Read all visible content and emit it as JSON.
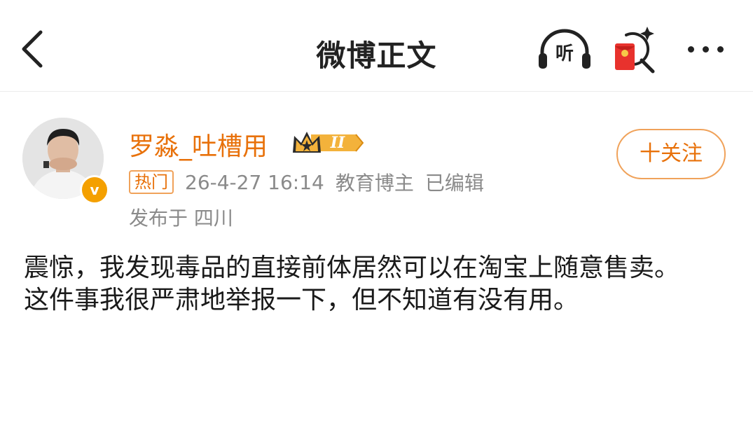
{
  "nav": {
    "title": "微博正文",
    "listen_label": "听"
  },
  "author": {
    "name": "罗淼_吐槽用",
    "vip_level": "II",
    "verified_mark": "v",
    "follow_label": "十关注",
    "hot_tag": "热门",
    "timestamp": "26-4-27 16:14",
    "role": "教育博主",
    "edited": "已编辑",
    "location": "发布于 四川"
  },
  "post": {
    "paragraphs": [
      "震惊，我发现毒品的直接前体居然可以在淘宝上随意售卖。",
      "这件事我很严肃地举报一下，但不知道有没有用。"
    ]
  },
  "colors": {
    "accent_orange": "#e8710a",
    "tag_border": "#f0a25a",
    "meta_gray": "#8a8a8a",
    "verified_gold": "#f4a000",
    "redpacket_red": "#e8322d"
  },
  "icons": [
    "back-icon",
    "headphones-icon",
    "red-packet-search-icon",
    "more-icon",
    "crown-icon",
    "verified-icon"
  ]
}
